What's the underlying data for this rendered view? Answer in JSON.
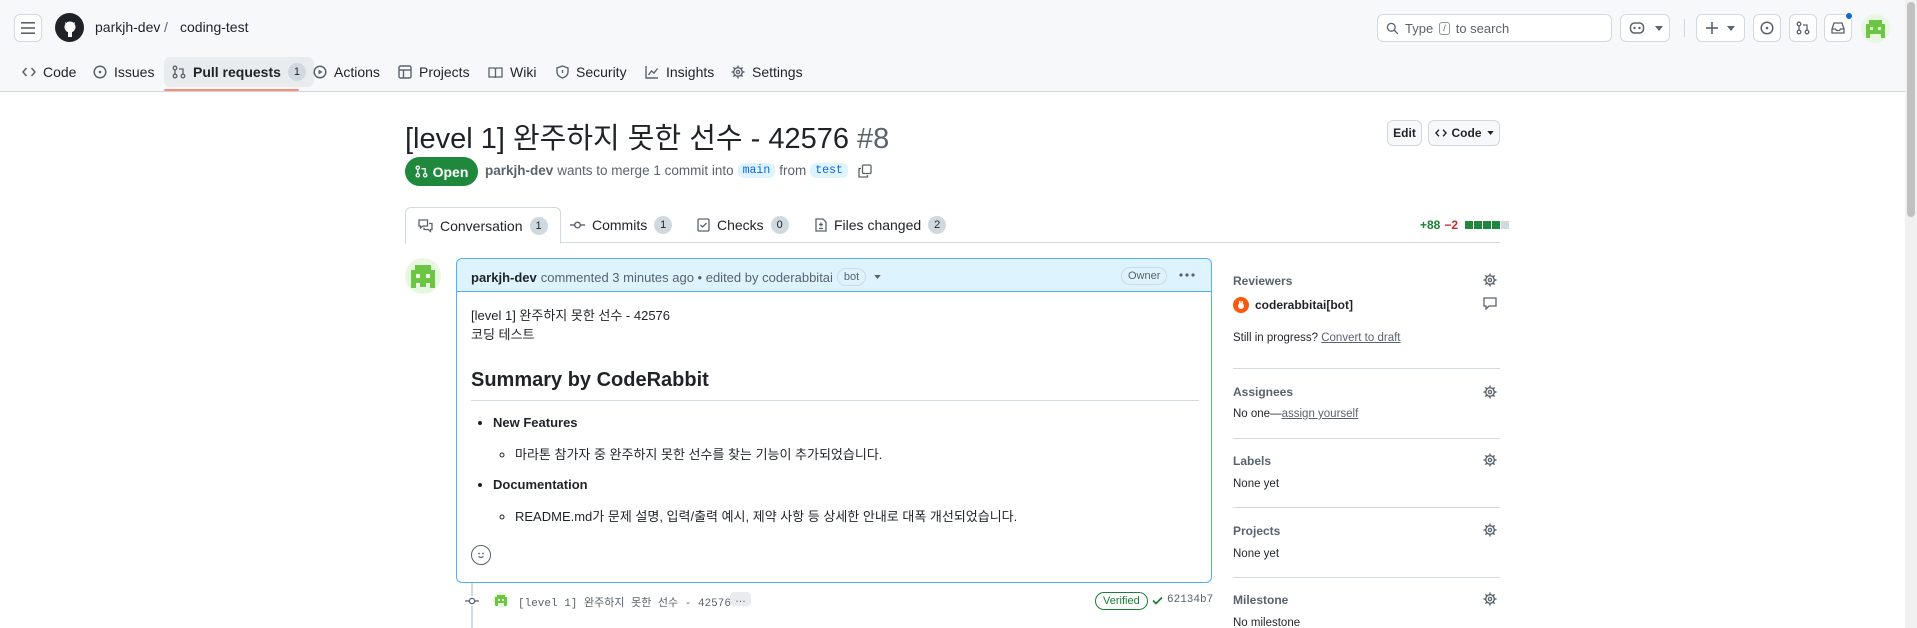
{
  "header": {
    "owner": "parkjh-dev",
    "separator": "/",
    "repo": "coding-test",
    "search": {
      "placeholder_pre": "Type",
      "key": "/",
      "placeholder_post": "to search"
    },
    "notification_dot_color": "#0969da"
  },
  "repo_tabs": [
    {
      "label": "Code",
      "icon": "code-icon"
    },
    {
      "label": "Issues",
      "icon": "issue-icon"
    },
    {
      "label": "Pull requests",
      "icon": "git-pull-request-icon",
      "count": "1",
      "active": true
    },
    {
      "label": "Actions",
      "icon": "play-icon"
    },
    {
      "label": "Projects",
      "icon": "table-icon"
    },
    {
      "label": "Wiki",
      "icon": "book-icon"
    },
    {
      "label": "Security",
      "icon": "shield-icon"
    },
    {
      "label": "Insights",
      "icon": "graph-icon"
    },
    {
      "label": "Settings",
      "icon": "gear-icon"
    }
  ],
  "pr": {
    "title": "[level 1] 완주하지 못한 선수 - 42576",
    "number": "#8",
    "edit_label": "Edit",
    "code_label": "Code",
    "state": "Open",
    "author": "parkjh-dev",
    "meta_text": "wants to merge 1 commit into",
    "base_branch": "main",
    "from_text": "from",
    "head_branch": "test"
  },
  "pr_tabs": [
    {
      "label": "Conversation",
      "count": "1",
      "icon": "comment-discussion-icon",
      "active": true
    },
    {
      "label": "Commits",
      "count": "1",
      "icon": "git-commit-icon"
    },
    {
      "label": "Checks",
      "count": "0",
      "icon": "checklist-icon"
    },
    {
      "label": "Files changed",
      "count": "2",
      "icon": "file-diff-icon"
    }
  ],
  "diffstat": {
    "additions": "+88",
    "deletions": "−2"
  },
  "comment": {
    "author": "parkjh-dev",
    "action": "commented 3 minutes ago • edited by coderabbitai",
    "bot_badge": "bot",
    "owner_badge": "Owner",
    "line1": "[level 1] 완주하지 못한 선수 - 42576",
    "line2": "코딩 테스트",
    "summary_heading": "Summary by CodeRabbit",
    "section1_title": "New Features",
    "section1_item": "마라톤 참가자 중 완주하지 못한 선수를 찾는 기능이 추가되었습니다.",
    "section2_title": "Documentation",
    "section2_item": "README.md가 문제 설명, 입력/출력 예시, 제약 사항 등 상세한 안내로 대폭 개선되었습니다."
  },
  "commit": {
    "message": "[level 1] 완주하지 못한 선수 - 42576",
    "more": "…",
    "verified": "Verified",
    "sha": "62134b7"
  },
  "sidebar": {
    "reviewers_title": "Reviewers",
    "reviewer_name": "coderabbitai[bot]",
    "in_progress_text": "Still in progress?",
    "convert_link": "Convert to draft",
    "assignees_title": "Assignees",
    "assignees_none": "No one—",
    "assign_yourself": "assign yourself",
    "labels_title": "Labels",
    "labels_value": "None yet",
    "projects_title": "Projects",
    "projects_value": "None yet",
    "milestone_title": "Milestone",
    "milestone_value": "No milestone"
  },
  "colors": {
    "open_green": "#1f883d",
    "accent_blue": "#0969da",
    "tab_underline": "#fd8c73",
    "comment_border": "#54aeff"
  }
}
